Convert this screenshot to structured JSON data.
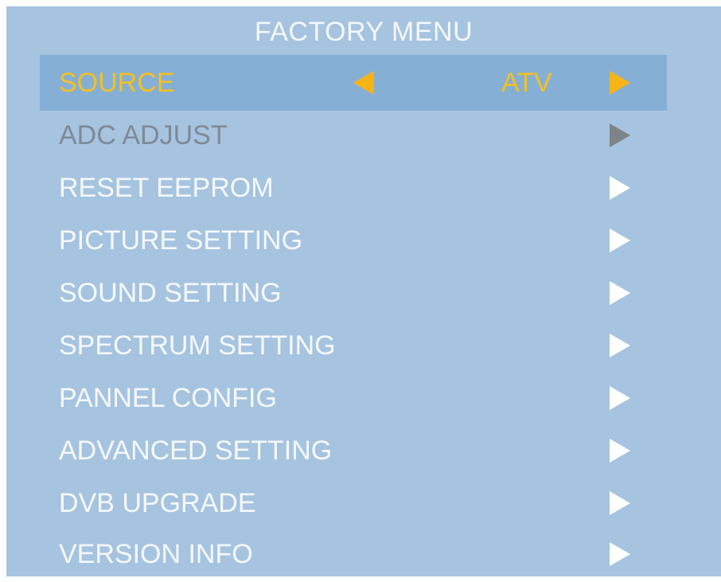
{
  "menu": {
    "title": "FACTORY MENU",
    "items": [
      {
        "label": "SOURCE",
        "value": "ATV",
        "state": "selected"
      },
      {
        "label": "ADC ADJUST",
        "state": "disabled"
      },
      {
        "label": "RESET EEPROM",
        "state": "normal"
      },
      {
        "label": "PICTURE SETTING",
        "state": "normal"
      },
      {
        "label": "SOUND SETTING",
        "state": "normal"
      },
      {
        "label": "SPECTRUM SETTING",
        "state": "normal"
      },
      {
        "label": "PANNEL CONFIG",
        "state": "normal"
      },
      {
        "label": "ADVANCED SETTING",
        "state": "normal"
      },
      {
        "label": "DVB UPGRADE",
        "state": "normal"
      },
      {
        "label": "VERSION INFO",
        "state": "normal"
      }
    ]
  },
  "colors": {
    "background": "#a6c4e0",
    "highlight": "#86afd6",
    "selected_text": "#f2c022",
    "arrow_selected": "#f7b416",
    "disabled": "#7e8a96"
  },
  "icons": {
    "left": "triangle-left-icon",
    "right": "triangle-right-icon"
  }
}
